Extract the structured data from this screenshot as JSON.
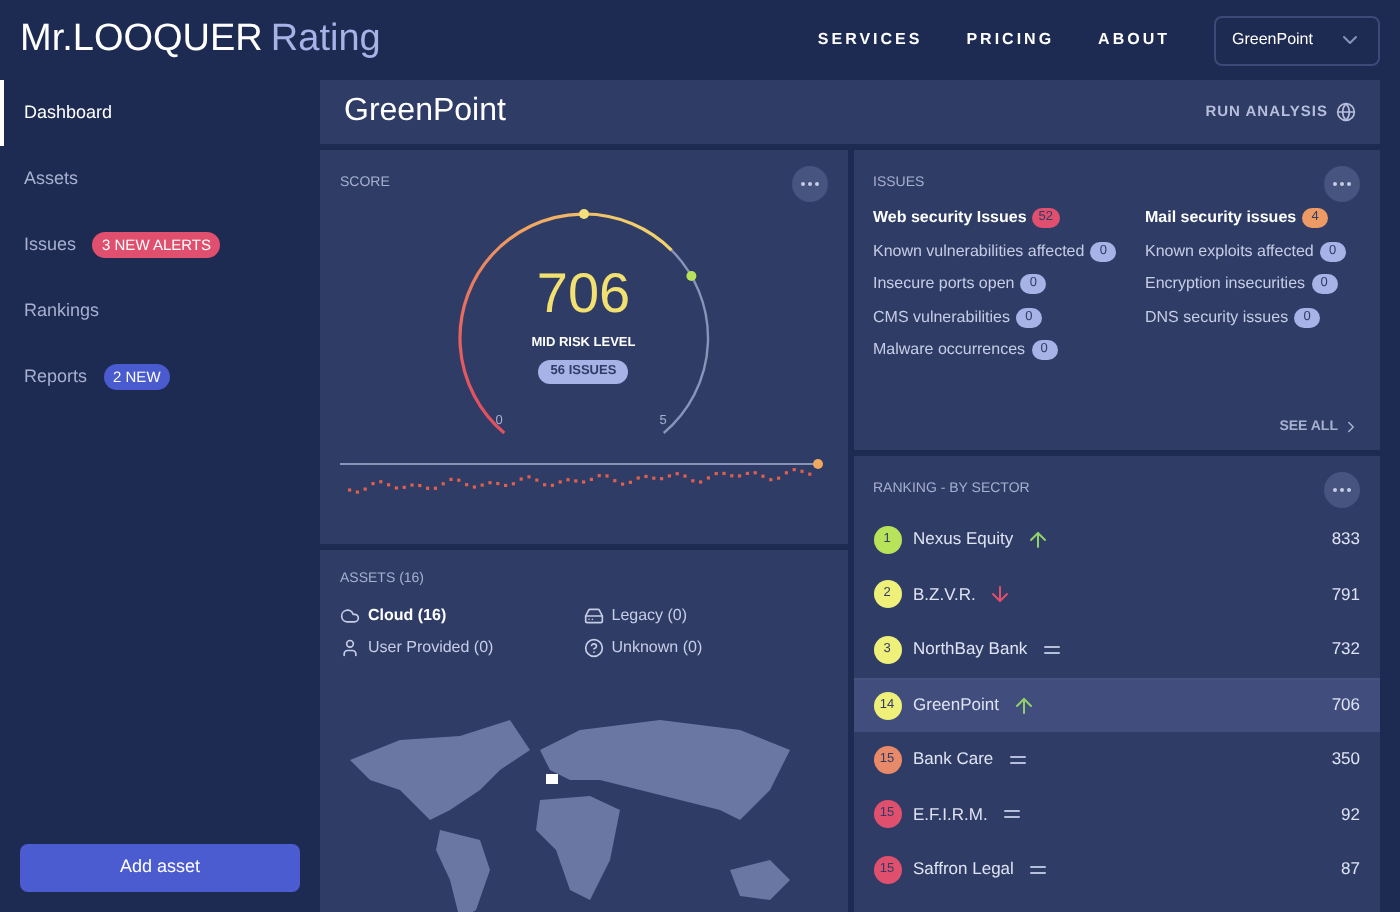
{
  "logo": {
    "name": "Mr.LOOQUER",
    "suffix": "Rating"
  },
  "nav": [
    "SERVICES",
    "PRICING",
    "ABOUT"
  ],
  "company_select": {
    "value": "GreenPoint"
  },
  "sidebar": {
    "items": [
      {
        "label": "Dashboard",
        "selected": true
      },
      {
        "label": "Assets",
        "selected": false
      },
      {
        "label": "Issues",
        "selected": false,
        "badge": {
          "text": "3 NEW ALERTS",
          "color": "#e0506e"
        }
      },
      {
        "label": "Rankings",
        "selected": false
      },
      {
        "label": "Reports",
        "selected": false,
        "badge": {
          "text": "2 NEW",
          "color": "#4a5bd0"
        }
      }
    ],
    "button": "Add asset"
  },
  "page": {
    "title": "GreenPoint",
    "action": "RUN ANALYSIS"
  },
  "score": {
    "title": "SCORE",
    "value": "706",
    "risk": "MID RISK LEVEL",
    "issues": "56 ISSUES",
    "min": "0",
    "max": "5"
  },
  "issues": {
    "title": "ISSUES",
    "columns": [
      [
        {
          "label": "Web security Issues",
          "count": "52",
          "kind": "header",
          "color": "#e0506e"
        },
        {
          "label": "Known vulnerabilities affected",
          "count": "0",
          "kind": "item"
        },
        {
          "label": "Insecure ports open",
          "count": "0",
          "kind": "item"
        },
        {
          "label": "CMS vulnerabilities",
          "count": "0",
          "kind": "item"
        },
        {
          "label": "Malware occurrences",
          "count": "0",
          "kind": "item"
        }
      ],
      [
        {
          "label": "Mail security issues",
          "count": "4",
          "kind": "header",
          "color": "#ee9a64"
        },
        {
          "label": "Known exploits affected",
          "count": "0",
          "kind": "item"
        },
        {
          "label": "Encryption insecurities",
          "count": "0",
          "kind": "item"
        },
        {
          "label": "DNS security issues",
          "count": "0",
          "kind": "item"
        }
      ]
    ],
    "link": "SEE ALL"
  },
  "ranking": {
    "title": "RANKING - BY SECTOR",
    "rows": [
      {
        "rank": "1",
        "name": "Nexus Equity",
        "kind": "up",
        "score": "833",
        "color": "#b6e35a",
        "selected": false
      },
      {
        "rank": "2",
        "name": "B.Z.V.R.",
        "kind": "down",
        "score": "791",
        "color": "#eef07a",
        "selected": false
      },
      {
        "rank": "3",
        "name": "NorthBay Bank",
        "kind": "same",
        "score": "732",
        "color": "#eef07a",
        "selected": false
      },
      {
        "rank": "14",
        "name": "GreenPoint",
        "kind": "up",
        "score": "706",
        "color": "#eef07a",
        "selected": true
      },
      {
        "rank": "15",
        "name": "Bank Care",
        "kind": "same",
        "score": "350",
        "color": "#e88a6a",
        "selected": false
      },
      {
        "rank": "15",
        "name": "E.F.I.R.M.",
        "kind": "same",
        "score": "92",
        "color": "#e0506e",
        "selected": false
      },
      {
        "rank": "15",
        "name": "Saffron Legal",
        "kind": "same",
        "score": "87",
        "color": "#e0506e",
        "selected": false
      }
    ]
  },
  "assets": {
    "title": "ASSETS (16)",
    "items": [
      {
        "kind": "cloud",
        "label": "Cloud (16)",
        "highlighted": true
      },
      {
        "kind": "legacy",
        "label": "Legacy (0)",
        "highlighted": false
      },
      {
        "kind": "user",
        "label": "User Provided (0)",
        "highlighted": false
      },
      {
        "kind": "unknown",
        "label": "Unknown (0)",
        "highlighted": false
      }
    ]
  }
}
